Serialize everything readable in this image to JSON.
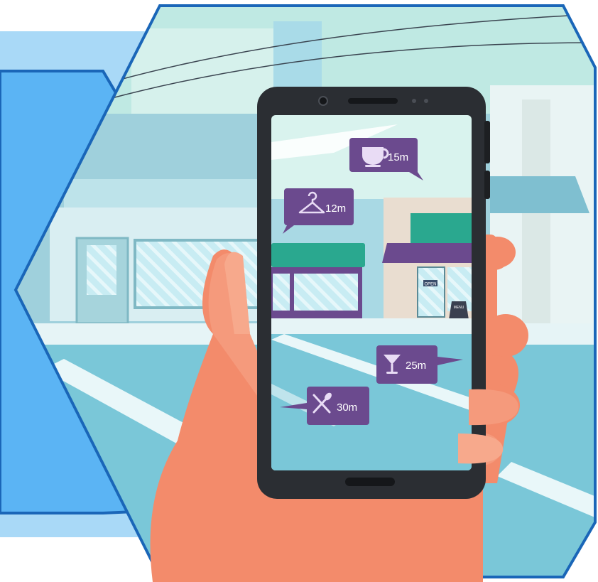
{
  "colors": {
    "panel_light": "#a9d9f7",
    "panel_mid": "#5bb4f4",
    "border": "#1a66b8",
    "sky": "#bfe9e3",
    "building": "#9fd0dc",
    "phone_body": "#2b2e33",
    "ar_bubble": "#6b4a8e",
    "hand": "#f38b6b",
    "awning_green": "#2aa88f",
    "awning_purple": "#6b4a8e"
  },
  "ar_markers": [
    {
      "icon": "coffee-cup-icon",
      "distance": "15m"
    },
    {
      "icon": "hanger-icon",
      "distance": "12m"
    },
    {
      "icon": "cocktail-glass-icon",
      "distance": "25m"
    },
    {
      "icon": "fork-knife-icon",
      "distance": "30m"
    }
  ],
  "storefront": {
    "door_sign": "OPEN",
    "board_sign": "MENU"
  }
}
